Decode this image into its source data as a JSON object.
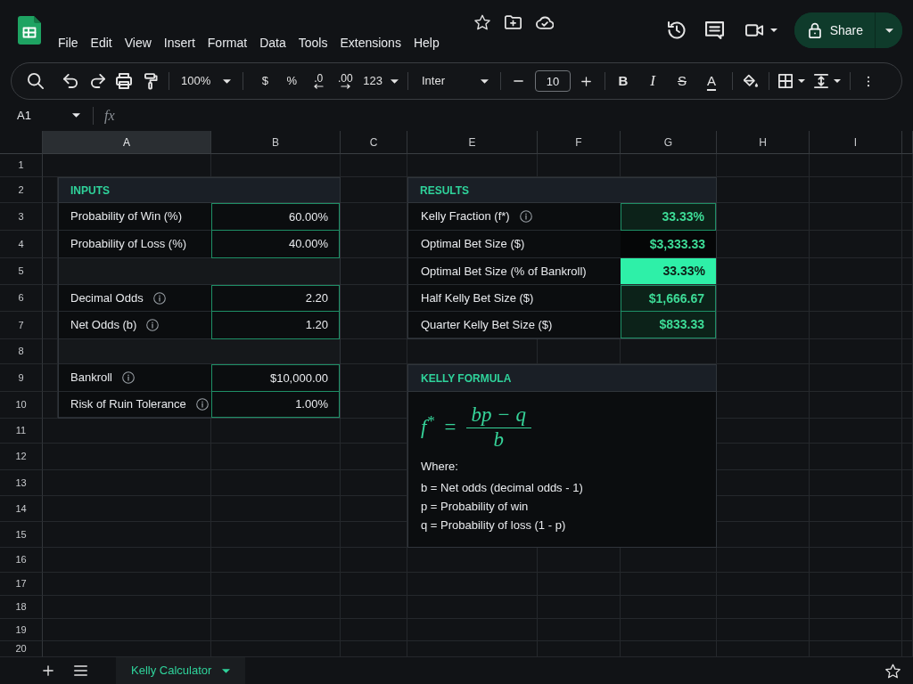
{
  "menu": {
    "items": [
      "File",
      "Edit",
      "View",
      "Insert",
      "Format",
      "Data",
      "Tools",
      "Extensions",
      "Help"
    ]
  },
  "share": {
    "label": "Share"
  },
  "toolbar": {
    "zoom": "100%",
    "currency": "$",
    "percent": "%",
    "decrease_decimals": ".0",
    "increase_decimals": ".00",
    "number_format": "123",
    "font": "Inter",
    "font_size": "10",
    "text_styles": [
      {
        "kind": "bold",
        "label": "B"
      },
      {
        "kind": "italic",
        "label": "I"
      },
      {
        "kind": "strikethrough",
        "label": "S"
      },
      {
        "kind": "color",
        "label": "A"
      }
    ]
  },
  "formula_bar": {
    "cell": "A1",
    "function_label": "fx"
  },
  "columns": [
    {
      "label": "A",
      "selected": true
    },
    {
      "label": "B",
      "selected": false
    },
    {
      "label": "C",
      "selected": false
    },
    {
      "label": "E",
      "selected": false
    },
    {
      "label": "F",
      "selected": false
    },
    {
      "label": "G",
      "selected": false
    },
    {
      "label": "H",
      "selected": false
    },
    {
      "label": "I",
      "selected": false
    }
  ],
  "rows": [
    "1",
    "2",
    "3",
    "4",
    "5",
    "6",
    "7",
    "8",
    "9",
    "10",
    "11",
    "12",
    "13",
    "14",
    "15",
    "16",
    "17",
    "18",
    "19",
    "20"
  ],
  "inputs": {
    "title": "INPUTS",
    "groups": [
      {
        "rows": [
          {
            "label": "Probability of Win (%)",
            "value": "60.00%",
            "info": false
          },
          {
            "label": "Probability of Loss (%)",
            "value": "40.00%",
            "info": false
          }
        ]
      },
      {
        "rows": [
          {
            "label": "Decimal Odds",
            "value": "2.20",
            "info": true
          },
          {
            "label": "Net Odds (b)",
            "value": "1.20",
            "info": true
          }
        ]
      },
      {
        "rows": [
          {
            "label": "Bankroll",
            "value": "$10,000.00",
            "info": true
          },
          {
            "label": "Risk of Ruin Tolerance",
            "value": "1.00%",
            "info": true
          }
        ]
      }
    ]
  },
  "results": {
    "title": "RESULTS",
    "rows": [
      {
        "label": "Kelly Fraction (f*)",
        "value": "33.33%",
        "info": true,
        "kind": "boxed"
      },
      {
        "label": "Optimal Bet Size ($)",
        "value": "$3,333.33",
        "info": false,
        "kind": "plain"
      },
      {
        "label": "Optimal Bet Size (% of Bankroll)",
        "value": "33.33%",
        "info": false,
        "kind": "filled"
      },
      {
        "label": "Half Kelly Bet Size ($)",
        "value": "$1,666.67",
        "info": false,
        "kind": "boxed"
      },
      {
        "label": "Quarter Kelly Bet Size ($)",
        "value": "$833.33",
        "info": false,
        "kind": "boxed"
      }
    ]
  },
  "formula": {
    "title": "KELLY FORMULA",
    "lhs": "f$^{*}$",
    "operator": "=",
    "numerator": "bp − q",
    "denominator": "b",
    "note": "Where:",
    "definitions": [
      "b = Net odds (decimal odds - 1)",
      "p = Probability of win",
      "q = Probability of loss (1 - p)"
    ]
  },
  "sheet_tabs": [
    {
      "label": "Kelly Calculator",
      "selected": true
    }
  ]
}
